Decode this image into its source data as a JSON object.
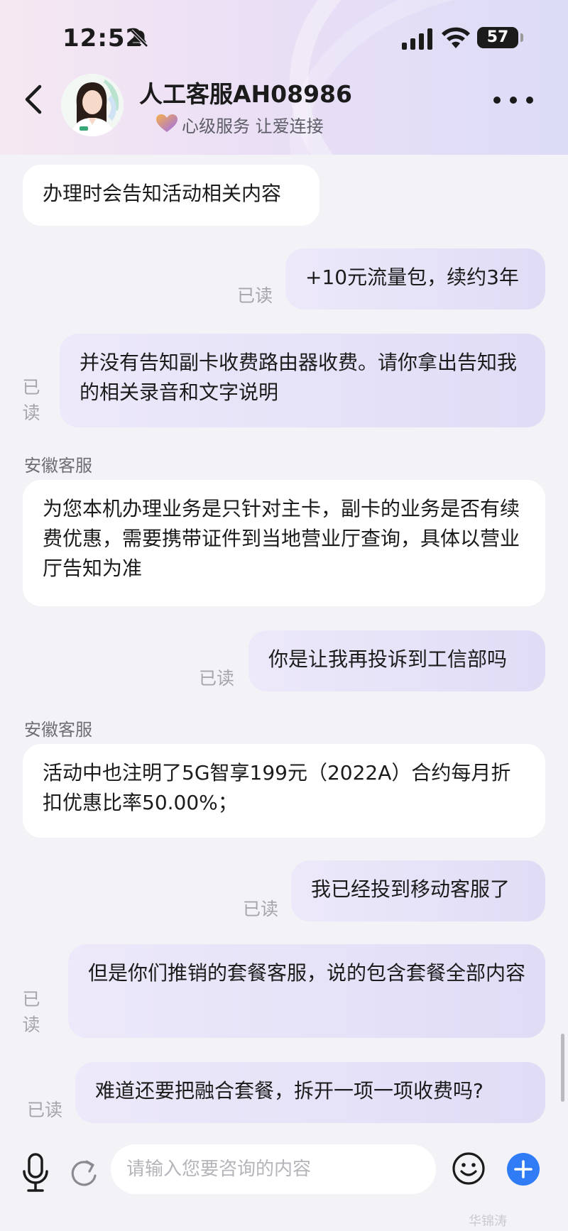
{
  "status_bar": {
    "time": "12:52",
    "battery": "57",
    "icons": [
      "bell-muted-icon",
      "signal-icon",
      "wifi-icon",
      "battery-icon"
    ]
  },
  "header": {
    "title": "人工客服AH08986",
    "slogan": "心级服务 让爱连接",
    "icons": [
      "back-icon",
      "heart-icon",
      "more-icon"
    ]
  },
  "chat": {
    "read_label": "已读",
    "sender_name": "安徽客服",
    "messages": [
      {
        "side": "in",
        "text": "办理时会告知活动相关内容"
      },
      {
        "side": "out",
        "text": "+10元流量包，续约3年",
        "status": "已读"
      },
      {
        "side": "out",
        "text": "并没有告知副卡收费路由器收费。请你拿出告知我的相关录音和文字说明",
        "status": "已读"
      },
      {
        "side": "in",
        "sender": "安徽客服",
        "text": "为您本机办理业务是只针对主卡，副卡的业务是否有续费优惠，需要携带证件到当地营业厅查询，具体以营业厅告知为准"
      },
      {
        "side": "out",
        "text": "你是让我再投诉到工信部吗",
        "status": "已读"
      },
      {
        "side": "in",
        "sender": "安徽客服",
        "text": "活动中也注明了5G智享199元（2022A）合约每月折扣优惠比率50.00%；"
      },
      {
        "side": "out",
        "text": "我已经投到移动客服了",
        "status": "已读"
      },
      {
        "side": "out",
        "text": "但是你们推销的套餐客服，说的包含套餐全部内容",
        "status": "已读"
      },
      {
        "side": "out",
        "text": "难道还要把融合套餐，拆开一项一项收费吗?",
        "status": "已读"
      }
    ]
  },
  "input": {
    "placeholder": "请输入您要咨询的内容",
    "value": ""
  },
  "bottom_icons": [
    "microphone-icon",
    "refresh-icon",
    "emoji-icon",
    "plus-icon"
  ],
  "watermark": "华锦涛",
  "colors": {
    "incoming_bubble": "#ffffff",
    "outgoing_bubble": "#e6e2f8",
    "background": "#f3f3f7",
    "accent": "#2f7cf6"
  }
}
